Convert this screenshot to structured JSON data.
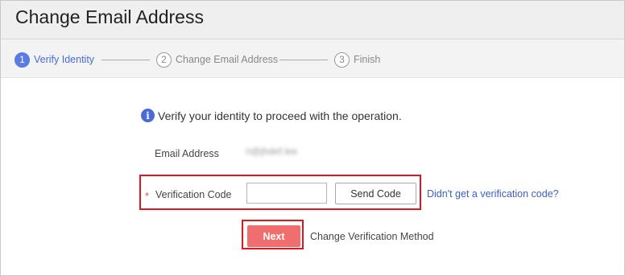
{
  "header": {
    "title": "Change Email Address"
  },
  "steps": [
    {
      "num": "1",
      "label": "Verify Identity",
      "active": true
    },
    {
      "num": "2",
      "label": "Change Email Address",
      "active": false
    },
    {
      "num": "3",
      "label": "Finish",
      "active": false
    }
  ],
  "form": {
    "notice": "Verify your identity to proceed with the operation.",
    "email_label": "Email Address",
    "email_value": "ri@jhdef.lee",
    "required_mark": "*",
    "code_label": "Verification Code",
    "code_value": "",
    "send_code_label": "Send Code",
    "no_code_link": "Didn't get a verification code?",
    "next_label": "Next",
    "change_method": "Change Verification Method"
  },
  "colors": {
    "accent": "#5b7be0",
    "link": "#3b5fc4",
    "next_button": "#f06e6e",
    "highlight_border": "#d9181f"
  },
  "icons": {
    "notice": "info-icon"
  }
}
